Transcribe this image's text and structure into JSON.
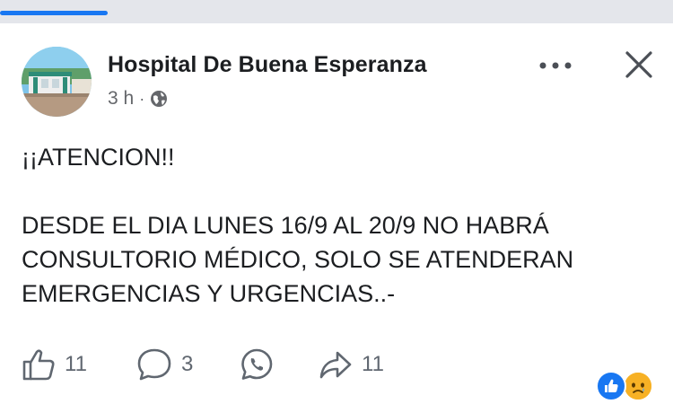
{
  "post": {
    "page_name": "Hospital De Buena Esperanza",
    "time": "3 h",
    "separator": "·",
    "audience_icon": "globe-icon",
    "text_lines": [
      "¡¡ATENCION!!",
      "",
      "DESDE EL DIA LUNES 16/9 AL 20/9 NO HABRÁ",
      "CONSULTORIO MÉDICO, SOLO SE ATENDERAN",
      "EMERGENCIAS Y URGENCIAS..-"
    ]
  },
  "header_actions": {
    "more_icon": "ellipsis-icon",
    "close_icon": "close-icon"
  },
  "actions": {
    "like_count": "11",
    "comment_count": "3",
    "share_count": "11",
    "like_icon": "thumbs-up-icon",
    "comment_icon": "comment-icon",
    "whatsapp_icon": "whatsapp-icon",
    "share_icon": "share-arrow-icon"
  },
  "reactions": [
    "like-reaction-icon",
    "sad-reaction-icon"
  ],
  "colors": {
    "brand_blue": "#1877f2",
    "text": "#1c1e21",
    "secondary_text": "#65676b",
    "strip": "#e4e6eb",
    "sad_yellow": "#f7b125"
  }
}
